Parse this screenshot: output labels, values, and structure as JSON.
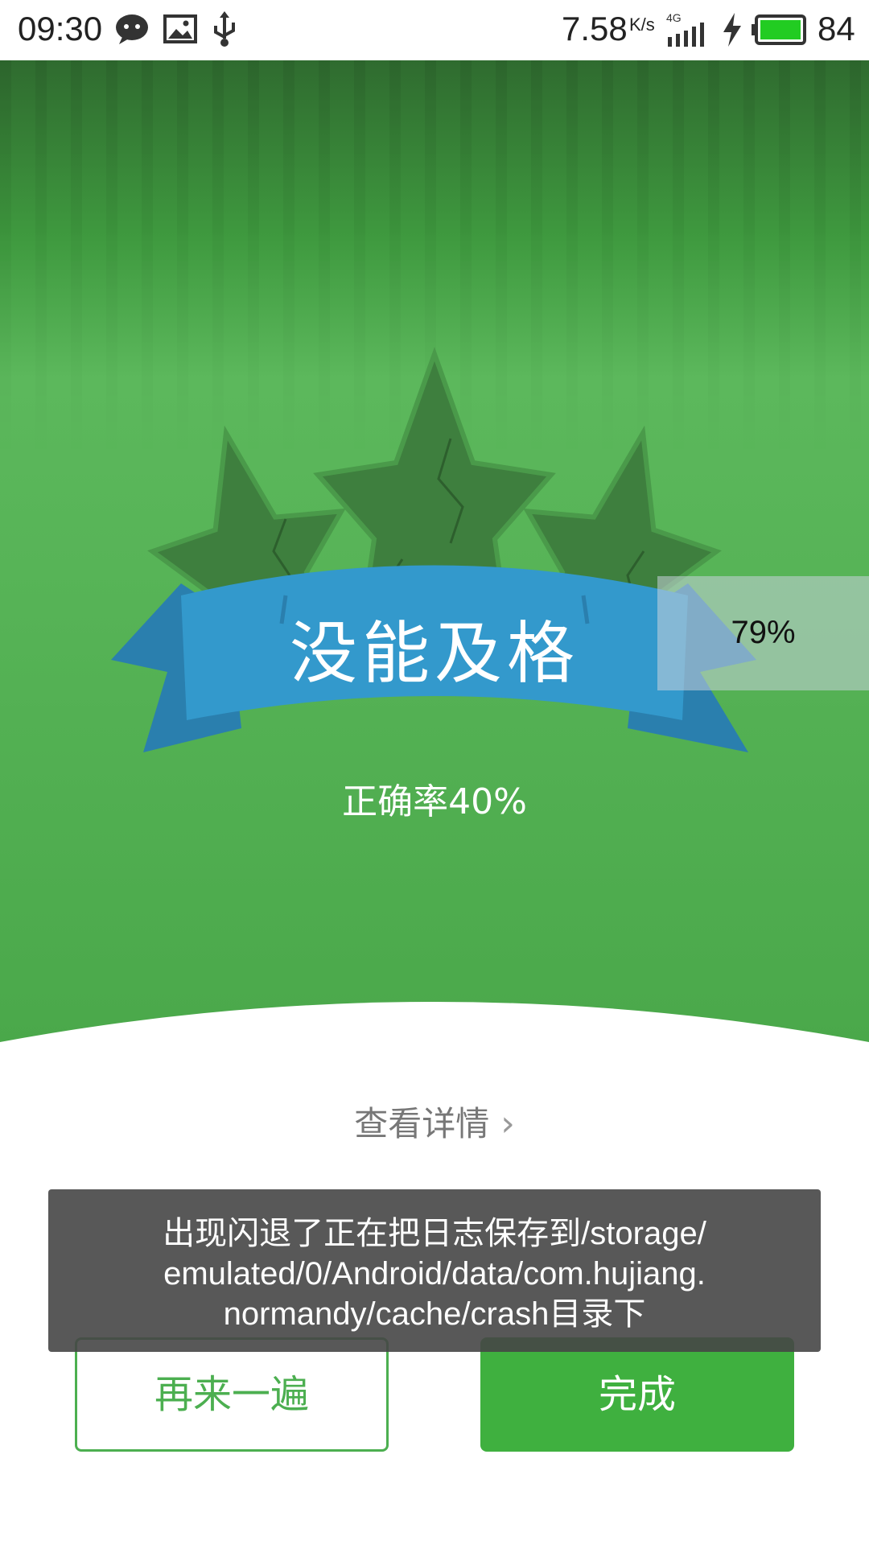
{
  "status_bar": {
    "time": "09:30",
    "network_speed": "7.58",
    "speed_unit": "K/s",
    "network_type": "4G",
    "battery_percent": "84",
    "icons": [
      "chat-bubble-icon",
      "image-icon",
      "usb-icon",
      "signal-icon",
      "charging-icon",
      "battery-icon"
    ]
  },
  "result": {
    "title": "没能及格",
    "accuracy": "正确率40%",
    "stars_earned": 0,
    "stars_total": 3
  },
  "progress_overlay": {
    "text": "79%"
  },
  "details_link": {
    "label": "查看详情"
  },
  "toast": {
    "message_line1": "出现闪退了正在把日志保存到/storage/",
    "message_line2": "emulated/0/Android/data/com.hujiang.",
    "message_line3": "normandy/cache/crash目录下"
  },
  "buttons": {
    "retry_label": "再来一遍",
    "done_label": "完成"
  },
  "colors": {
    "hero_green": "#5cb85c",
    "ribbon_blue": "#3399cc",
    "star_dark_green": "#3e7f3e",
    "button_green": "#3fb03f"
  }
}
